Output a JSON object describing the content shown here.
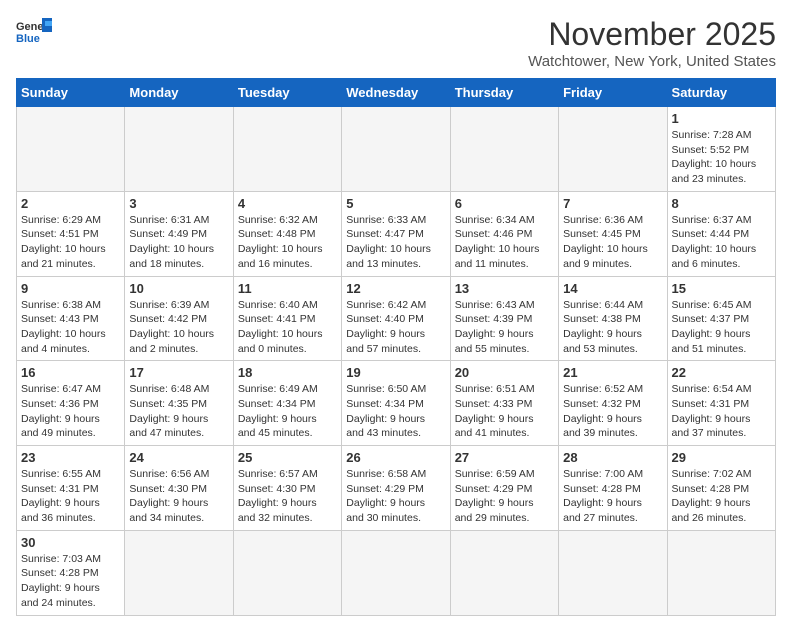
{
  "header": {
    "logo_general": "General",
    "logo_blue": "Blue",
    "month": "November 2025",
    "location": "Watchtower, New York, United States"
  },
  "weekdays": [
    "Sunday",
    "Monday",
    "Tuesday",
    "Wednesday",
    "Thursday",
    "Friday",
    "Saturday"
  ],
  "weeks": [
    [
      {
        "day": "",
        "info": ""
      },
      {
        "day": "",
        "info": ""
      },
      {
        "day": "",
        "info": ""
      },
      {
        "day": "",
        "info": ""
      },
      {
        "day": "",
        "info": ""
      },
      {
        "day": "",
        "info": ""
      },
      {
        "day": "1",
        "info": "Sunrise: 7:28 AM\nSunset: 5:52 PM\nDaylight: 10 hours\nand 23 minutes."
      }
    ],
    [
      {
        "day": "2",
        "info": "Sunrise: 6:29 AM\nSunset: 4:51 PM\nDaylight: 10 hours\nand 21 minutes."
      },
      {
        "day": "3",
        "info": "Sunrise: 6:31 AM\nSunset: 4:49 PM\nDaylight: 10 hours\nand 18 minutes."
      },
      {
        "day": "4",
        "info": "Sunrise: 6:32 AM\nSunset: 4:48 PM\nDaylight: 10 hours\nand 16 minutes."
      },
      {
        "day": "5",
        "info": "Sunrise: 6:33 AM\nSunset: 4:47 PM\nDaylight: 10 hours\nand 13 minutes."
      },
      {
        "day": "6",
        "info": "Sunrise: 6:34 AM\nSunset: 4:46 PM\nDaylight: 10 hours\nand 11 minutes."
      },
      {
        "day": "7",
        "info": "Sunrise: 6:36 AM\nSunset: 4:45 PM\nDaylight: 10 hours\nand 9 minutes."
      },
      {
        "day": "8",
        "info": "Sunrise: 6:37 AM\nSunset: 4:44 PM\nDaylight: 10 hours\nand 6 minutes."
      }
    ],
    [
      {
        "day": "9",
        "info": "Sunrise: 6:38 AM\nSunset: 4:43 PM\nDaylight: 10 hours\nand 4 minutes."
      },
      {
        "day": "10",
        "info": "Sunrise: 6:39 AM\nSunset: 4:42 PM\nDaylight: 10 hours\nand 2 minutes."
      },
      {
        "day": "11",
        "info": "Sunrise: 6:40 AM\nSunset: 4:41 PM\nDaylight: 10 hours\nand 0 minutes."
      },
      {
        "day": "12",
        "info": "Sunrise: 6:42 AM\nSunset: 4:40 PM\nDaylight: 9 hours\nand 57 minutes."
      },
      {
        "day": "13",
        "info": "Sunrise: 6:43 AM\nSunset: 4:39 PM\nDaylight: 9 hours\nand 55 minutes."
      },
      {
        "day": "14",
        "info": "Sunrise: 6:44 AM\nSunset: 4:38 PM\nDaylight: 9 hours\nand 53 minutes."
      },
      {
        "day": "15",
        "info": "Sunrise: 6:45 AM\nSunset: 4:37 PM\nDaylight: 9 hours\nand 51 minutes."
      }
    ],
    [
      {
        "day": "16",
        "info": "Sunrise: 6:47 AM\nSunset: 4:36 PM\nDaylight: 9 hours\nand 49 minutes."
      },
      {
        "day": "17",
        "info": "Sunrise: 6:48 AM\nSunset: 4:35 PM\nDaylight: 9 hours\nand 47 minutes."
      },
      {
        "day": "18",
        "info": "Sunrise: 6:49 AM\nSunset: 4:34 PM\nDaylight: 9 hours\nand 45 minutes."
      },
      {
        "day": "19",
        "info": "Sunrise: 6:50 AM\nSunset: 4:34 PM\nDaylight: 9 hours\nand 43 minutes."
      },
      {
        "day": "20",
        "info": "Sunrise: 6:51 AM\nSunset: 4:33 PM\nDaylight: 9 hours\nand 41 minutes."
      },
      {
        "day": "21",
        "info": "Sunrise: 6:52 AM\nSunset: 4:32 PM\nDaylight: 9 hours\nand 39 minutes."
      },
      {
        "day": "22",
        "info": "Sunrise: 6:54 AM\nSunset: 4:31 PM\nDaylight: 9 hours\nand 37 minutes."
      }
    ],
    [
      {
        "day": "23",
        "info": "Sunrise: 6:55 AM\nSunset: 4:31 PM\nDaylight: 9 hours\nand 36 minutes."
      },
      {
        "day": "24",
        "info": "Sunrise: 6:56 AM\nSunset: 4:30 PM\nDaylight: 9 hours\nand 34 minutes."
      },
      {
        "day": "25",
        "info": "Sunrise: 6:57 AM\nSunset: 4:30 PM\nDaylight: 9 hours\nand 32 minutes."
      },
      {
        "day": "26",
        "info": "Sunrise: 6:58 AM\nSunset: 4:29 PM\nDaylight: 9 hours\nand 30 minutes."
      },
      {
        "day": "27",
        "info": "Sunrise: 6:59 AM\nSunset: 4:29 PM\nDaylight: 9 hours\nand 29 minutes."
      },
      {
        "day": "28",
        "info": "Sunrise: 7:00 AM\nSunset: 4:28 PM\nDaylight: 9 hours\nand 27 minutes."
      },
      {
        "day": "29",
        "info": "Sunrise: 7:02 AM\nSunset: 4:28 PM\nDaylight: 9 hours\nand 26 minutes."
      }
    ],
    [
      {
        "day": "30",
        "info": "Sunrise: 7:03 AM\nSunset: 4:28 PM\nDaylight: 9 hours\nand 24 minutes."
      },
      {
        "day": "",
        "info": ""
      },
      {
        "day": "",
        "info": ""
      },
      {
        "day": "",
        "info": ""
      },
      {
        "day": "",
        "info": ""
      },
      {
        "day": "",
        "info": ""
      },
      {
        "day": "",
        "info": ""
      }
    ]
  ]
}
